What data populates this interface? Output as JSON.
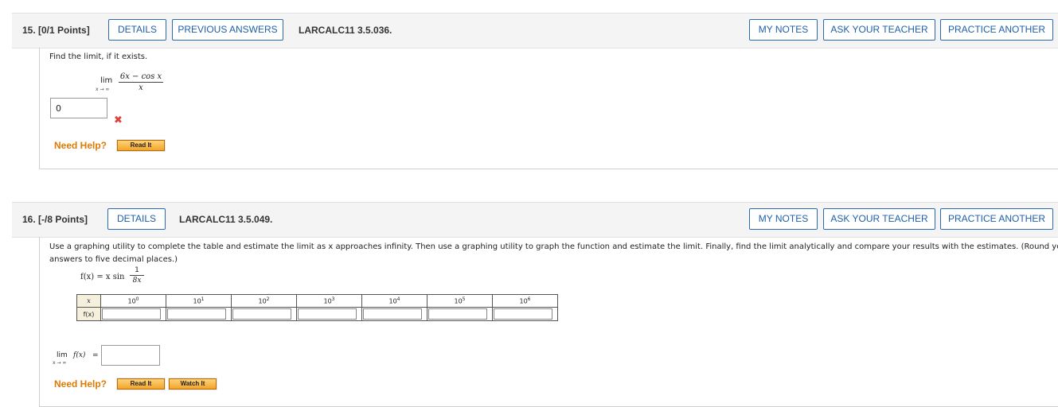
{
  "q15": {
    "number": "15. [0/1 Points]",
    "details_label": "DETAILS",
    "previous_label": "PREVIOUS ANSWERS",
    "code": "LARCALC11 3.5.036.",
    "my_notes": "MY NOTES",
    "ask_teacher": "ASK YOUR TEACHER",
    "practice": "PRACTICE ANOTHER",
    "prompt": "Find the limit, if it exists.",
    "lim": "lim",
    "lim_sub": "x → ∞",
    "numerator": "6x − cos x",
    "denominator": "x",
    "answer_value": "0",
    "wrong_mark": "✖",
    "need_help": "Need Help?",
    "read_it": "Read It"
  },
  "q16": {
    "number": "16. [-/8 Points]",
    "details_label": "DETAILS",
    "code": "LARCALC11 3.5.049.",
    "my_notes": "MY NOTES",
    "ask_teacher": "ASK YOUR TEACHER",
    "practice": "PRACTICE ANOTHER",
    "prompt_line1": "Use a graphing utility to complete the table and estimate the limit as x approaches infinity. Then use a graphing utility to graph the function and estimate the limit. Finally, find the limit analytically and compare your results with the estimates. (Round your",
    "prompt_line2": "answers to five decimal places.)",
    "func_lhs": "f(x) = x sin",
    "func_num": "1",
    "func_den": "8x",
    "table": {
      "row_x_label": "x",
      "row_f_label": "f(x)",
      "exponents": [
        "0",
        "1",
        "2",
        "3",
        "4",
        "5",
        "6"
      ],
      "base": "10"
    },
    "lim": "lim",
    "lim_fx": "f(x)",
    "lim_eq": "=",
    "lim_sub": "x → ∞",
    "need_help": "Need Help?",
    "read_it": "Read It",
    "watch_it": "Watch It"
  }
}
